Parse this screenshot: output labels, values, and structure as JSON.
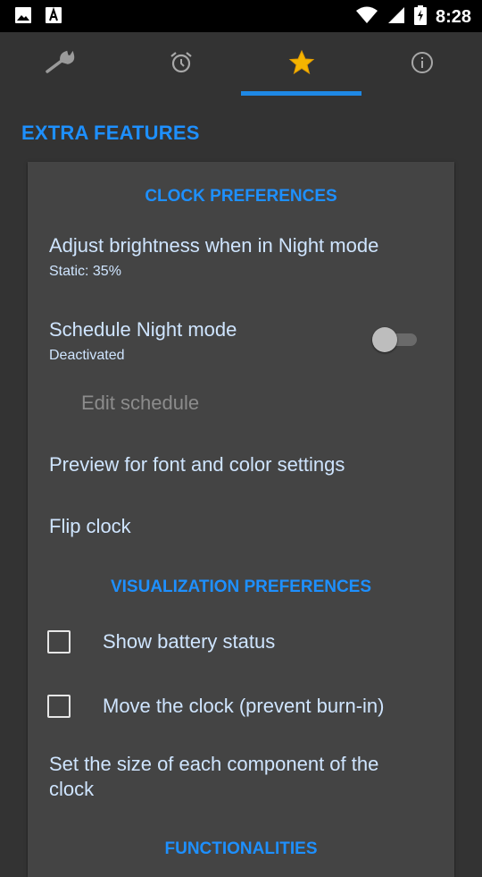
{
  "status": {
    "time": "8:28"
  },
  "tabs": [
    {
      "name": "settings",
      "icon": "wrench-icon"
    },
    {
      "name": "alarm",
      "icon": "alarm-clock-icon"
    },
    {
      "name": "extras",
      "icon": "star-icon"
    },
    {
      "name": "info",
      "icon": "info-icon"
    }
  ],
  "section_title": "EXTRA FEATURES",
  "clock_prefs": {
    "header": "CLOCK PREFERENCES",
    "brightness_title": "Adjust brightness when in Night mode",
    "brightness_sub": "Static: 35%",
    "schedule_title": "Schedule Night mode",
    "schedule_sub": "Deactivated",
    "schedule_enabled": false,
    "edit_schedule": "Edit schedule",
    "preview": "Preview for font and color settings",
    "flip": "Flip clock"
  },
  "viz_prefs": {
    "header": "VISUALIZATION PREFERENCES",
    "battery_label": "Show battery status",
    "battery_checked": false,
    "move_label": "Move the clock (prevent burn-in)",
    "move_checked": false,
    "size_label_line1": "Set the size of each component of the",
    "size_label_line2": "clock"
  },
  "functionalities": {
    "header": "FUNCTIONALITIES"
  },
  "colors": {
    "accent": "#1e90ff",
    "background": "#333333",
    "card": "#444444",
    "text": "#cfe5ff"
  }
}
